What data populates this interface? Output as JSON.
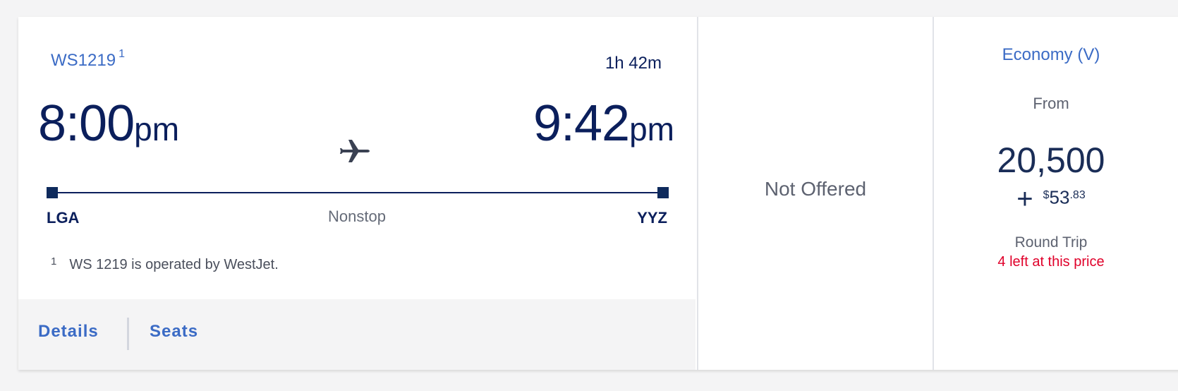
{
  "flight": {
    "number": "WS1219",
    "footnote_marker": "1",
    "duration": "1h 42m",
    "departure": {
      "time": "8:00",
      "suffix": "pm",
      "airport": "LGA"
    },
    "arrival": {
      "time": "9:42",
      "suffix": "pm",
      "airport": "YYZ"
    },
    "stops": "Nonstop",
    "footnote": {
      "marker": "1",
      "text": "WS 1219 is operated by WestJet."
    },
    "icon": "airplane-icon"
  },
  "actions": {
    "details_label": "Details",
    "seats_label": "Seats"
  },
  "basic_fare": {
    "status": "Not Offered"
  },
  "economy_fare": {
    "class_label": "Economy (V)",
    "from_label": "From",
    "miles": "20,500",
    "fee_plus": "+",
    "fee_currency": "$",
    "fee_dollars": "53",
    "fee_cents": ".83",
    "trip_type": "Round Trip",
    "availability": "4 left at this price"
  },
  "colors": {
    "primary_navy": "#0b1f5c",
    "link_blue": "#3b6bc5",
    "alert_red": "#e0002a",
    "muted_gray": "#5d6270"
  }
}
